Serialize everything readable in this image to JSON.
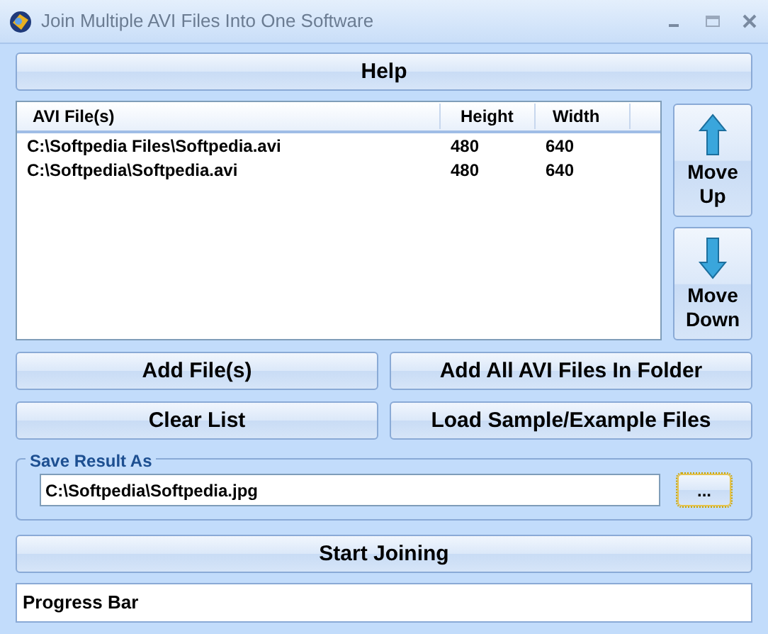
{
  "window": {
    "title": "Join Multiple AVI Files Into One Software"
  },
  "help_button": "Help",
  "file_list": {
    "columns": [
      "AVI File(s)",
      "Height",
      "Width"
    ],
    "rows": [
      [
        "C:\\Softpedia Files\\Softpedia.avi",
        "480",
        "640"
      ],
      [
        "C:\\Softpedia\\Softpedia.avi",
        "480",
        "640"
      ]
    ]
  },
  "move_buttons": [
    {
      "label": "Move Up",
      "kind": "up"
    },
    {
      "label": "Move Down",
      "kind": "down"
    }
  ],
  "action_buttons": [
    "Add File(s)",
    "Add All AVI Files In Folder",
    "Clear List",
    "Load Sample/Example Files"
  ],
  "save_result": {
    "label": "Save Result As",
    "value": "C:\\Softpedia\\Softpedia.jpg",
    "browse_button": {
      "label": "...",
      "focused": true
    }
  },
  "start_button": "Start Joining",
  "progress_bar": {
    "label": "Progress Bar",
    "level": 0
  }
}
